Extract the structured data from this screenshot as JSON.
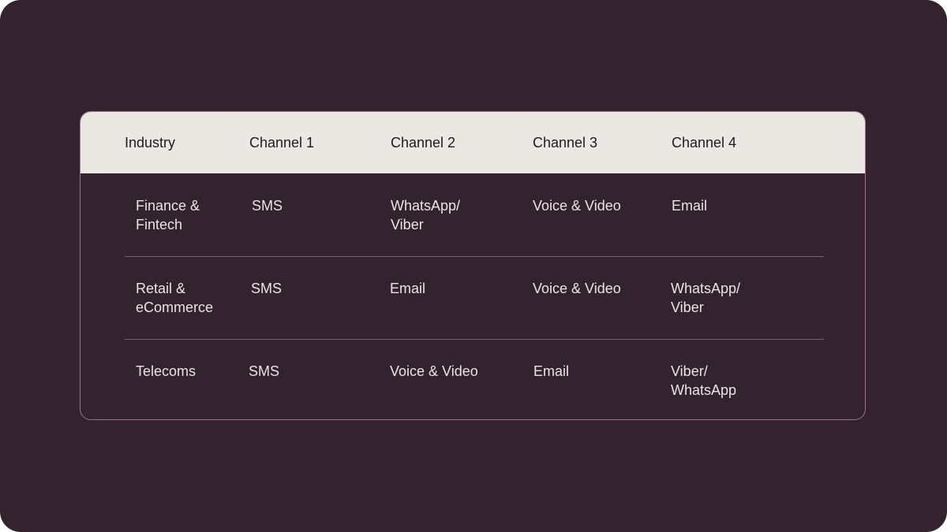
{
  "table": {
    "headers": [
      "Industry",
      "Channel 1",
      "Channel 2",
      "Channel 3",
      "Channel 4"
    ],
    "rows": [
      [
        "Finance &\nFintech",
        "SMS",
        "WhatsApp/\nViber",
        "Voice & Video",
        "Email"
      ],
      [
        "Retail &\neCommerce",
        "SMS",
        "Email",
        "Voice & Video",
        "WhatsApp/\nViber"
      ],
      [
        "Telecoms",
        "SMS",
        "Voice & Video",
        "Email",
        "Viber/\nWhatsApp"
      ]
    ]
  },
  "colors": {
    "background": "#33232f",
    "header_bg": "#ebe7e3",
    "header_text": "#1f1a1e",
    "cell_text": "#ebe2ea",
    "border": "#9a7396",
    "divider": "#7d5c7b"
  }
}
